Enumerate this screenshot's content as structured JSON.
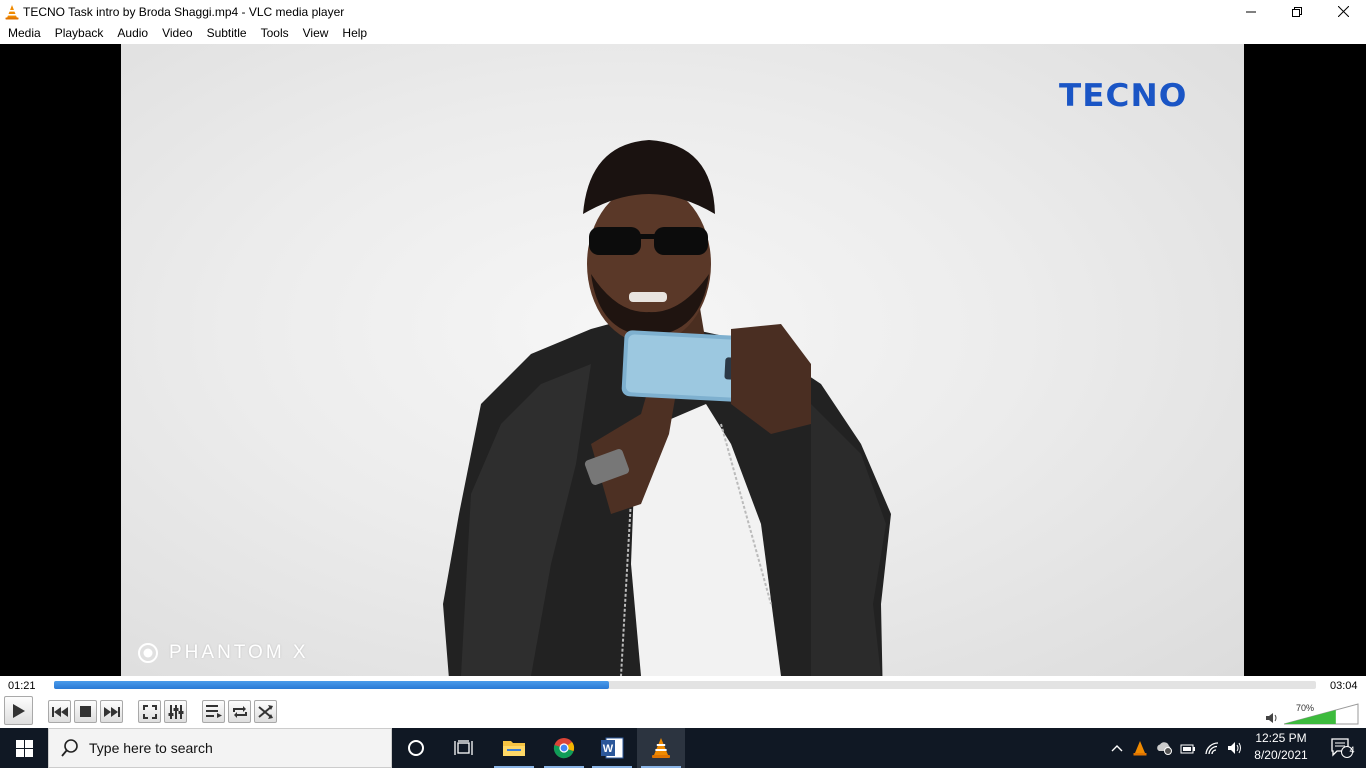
{
  "window": {
    "title": "TECNO Task intro by Broda Shaggi.mp4 - VLC media player",
    "icon": "vlc-cone-icon"
  },
  "menu": {
    "items": [
      "Media",
      "Playback",
      "Audio",
      "Video",
      "Subtitle",
      "Tools",
      "View",
      "Help"
    ]
  },
  "video": {
    "brand_logo": "TECNO",
    "watermark": "PHANTOM X"
  },
  "playback": {
    "elapsed": "01:21",
    "duration": "03:04",
    "progress_fraction": 0.44
  },
  "volume": {
    "label": "70%",
    "level_fraction": 0.7
  },
  "taskbar": {
    "search_placeholder": "Type here to search",
    "time": "12:25 PM",
    "date": "8/20/2021",
    "notification_count": "4"
  },
  "colors": {
    "accent_seek": "#2a7ad5",
    "brand_blue": "#1a55c5",
    "taskbar_bg": "#101824",
    "volume_green": "#3dbb3d"
  }
}
